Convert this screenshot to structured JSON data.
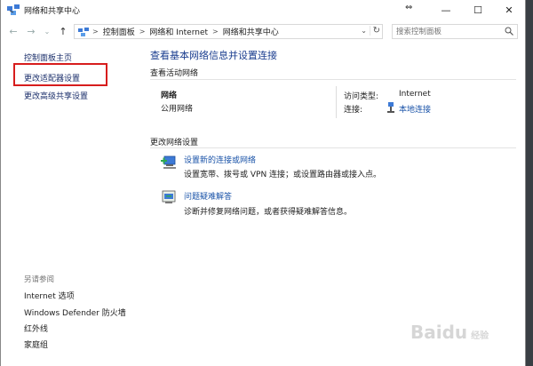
{
  "window": {
    "title": "网络和共享中心"
  },
  "titlebar": {
    "minimize": "—",
    "maximize": "☐",
    "close": "✕",
    "resize": "⇔"
  },
  "nav": {
    "back": "←",
    "forward": "→",
    "dropdown": "⌄",
    "up": "↑",
    "breadcrumbs": [
      "控制面板",
      "网络和 Internet",
      "网络和共享中心"
    ],
    "separator": ">",
    "address_dropdown": "⌄",
    "refresh": "↻"
  },
  "search": {
    "placeholder": "搜索控制面板"
  },
  "sidebar": {
    "home": "控制面板主页",
    "adapter_settings": "更改适配器设置",
    "advanced_sharing": "更改高级共享设置",
    "see_also_heading": "另请参阅",
    "see_also": [
      "Internet 选项",
      "Windows Defender 防火墙",
      "红外线",
      "家庭组"
    ]
  },
  "main": {
    "title": "查看基本网络信息并设置连接",
    "active_networks_heading": "查看活动网络",
    "network_name": "网络",
    "network_type": "公用网络",
    "access_type_label": "访问类型:",
    "access_type_value": "Internet",
    "connections_label": "连接:",
    "connections_value": "本地连接",
    "change_settings_heading": "更改网络设置",
    "tasks": [
      {
        "link": "设置新的连接或网络",
        "desc": "设置宽带、拨号或 VPN 连接；或设置路由器或接入点。"
      },
      {
        "link": "问题疑难解答",
        "desc": "诊断并修复网络问题，或者获得疑难解答信息。"
      }
    ]
  },
  "watermark": {
    "text": "Baidu",
    "sub": "经验"
  },
  "colors": {
    "link": "#1a53a8",
    "title": "#1a3d8f",
    "highlight": "#d71d1d"
  }
}
